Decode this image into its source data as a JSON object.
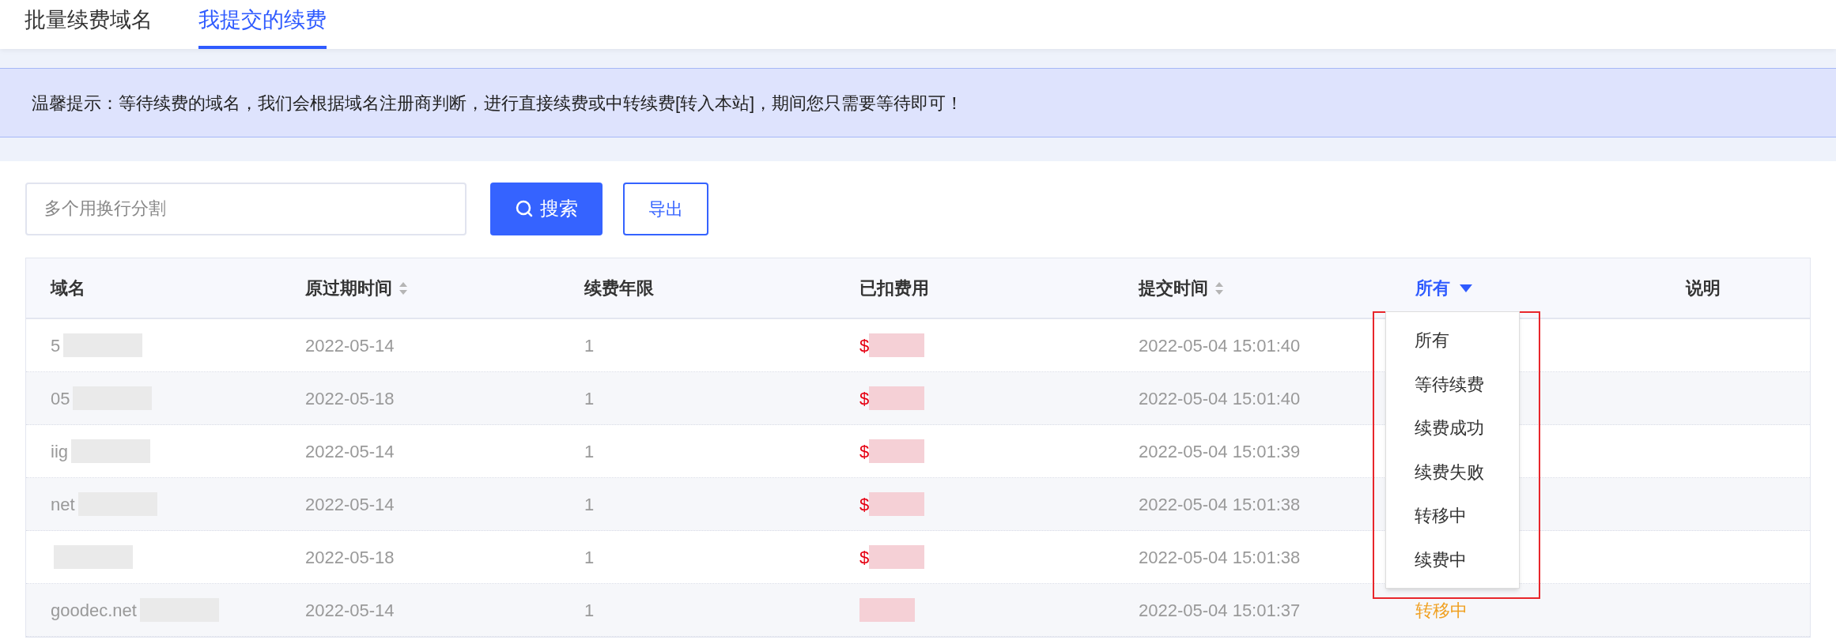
{
  "tabs": [
    {
      "label": "批量续费域名",
      "selected": false
    },
    {
      "label": "我提交的续费",
      "selected": true
    }
  ],
  "notice": "温馨提示：等待续费的域名，我们会根据域名注册商判断，进行直接续费或中转续费[转入本站]，期间您只需要等待即可！",
  "search": {
    "placeholder": "多个用换行分割",
    "button": "搜索"
  },
  "export_button": "导出",
  "table": {
    "columns": [
      {
        "label": "域名",
        "kind": "plain"
      },
      {
        "label": "原过期时间",
        "kind": "sortable"
      },
      {
        "label": "续费年限",
        "kind": "plain"
      },
      {
        "label": "已扣费用",
        "kind": "plain"
      },
      {
        "label": "提交时间",
        "kind": "sortable"
      },
      {
        "label": "所有",
        "kind": "filter"
      },
      {
        "label": "说明",
        "kind": "plain"
      }
    ],
    "rows": [
      {
        "domain": "5",
        "expiry": "2022-05-14",
        "years": "1",
        "fee": "$",
        "submitted": "2022-05-04 15:01:40"
      },
      {
        "domain": "05",
        "expiry": "2022-05-18",
        "years": "1",
        "fee": "$",
        "submitted": "2022-05-04 15:01:40"
      },
      {
        "domain": "iig",
        "expiry": "2022-05-14",
        "years": "1",
        "fee": "$",
        "submitted": "2022-05-04 15:01:39"
      },
      {
        "domain": "net",
        "expiry": "2022-05-14",
        "years": "1",
        "fee": "$",
        "submitted": "2022-05-04 15:01:38"
      },
      {
        "domain": "",
        "expiry": "2022-05-18",
        "years": "1",
        "fee": "$",
        "submitted": "2022-05-04 15:01:38"
      },
      {
        "domain": "goodec.net",
        "expiry": "2022-05-14",
        "years": "1",
        "fee": "",
        "submitted": "2022-05-04 15:01:37",
        "status": "转移中"
      }
    ]
  },
  "filter_menu": [
    "所有",
    "等待续费",
    "续费成功",
    "续费失败",
    "转移中",
    "续费中"
  ]
}
